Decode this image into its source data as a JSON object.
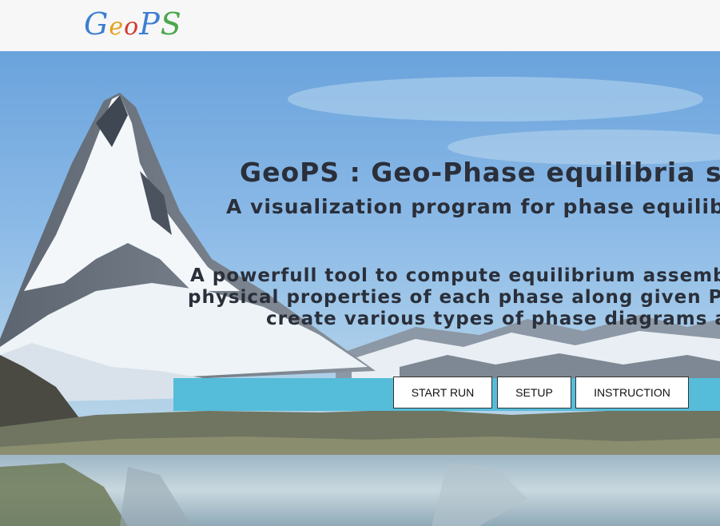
{
  "logo": {
    "letters": [
      "G",
      "e",
      "o",
      "P",
      "S"
    ],
    "colors": [
      "#3b7fd0",
      "#e2a21a",
      "#d23a2e",
      "#3f7fd2",
      "#4aa84a"
    ]
  },
  "hero": {
    "headline": "GeoPS : Geo-Phase equilibria si",
    "subhead": "A visualization program for phase equilibria",
    "description": [
      "A powerfull tool to compute equilibrium assemblag",
      "physical properties of each phase along given P-T-X",
      "create various types of phase diagrams and"
    ]
  },
  "buttons": {
    "start_run": "START RUN",
    "setup": "SETUP",
    "instruction": "INSTRUCTION"
  },
  "colors": {
    "accent_bar": "#55bcd9",
    "sky": "#8fbce8"
  }
}
